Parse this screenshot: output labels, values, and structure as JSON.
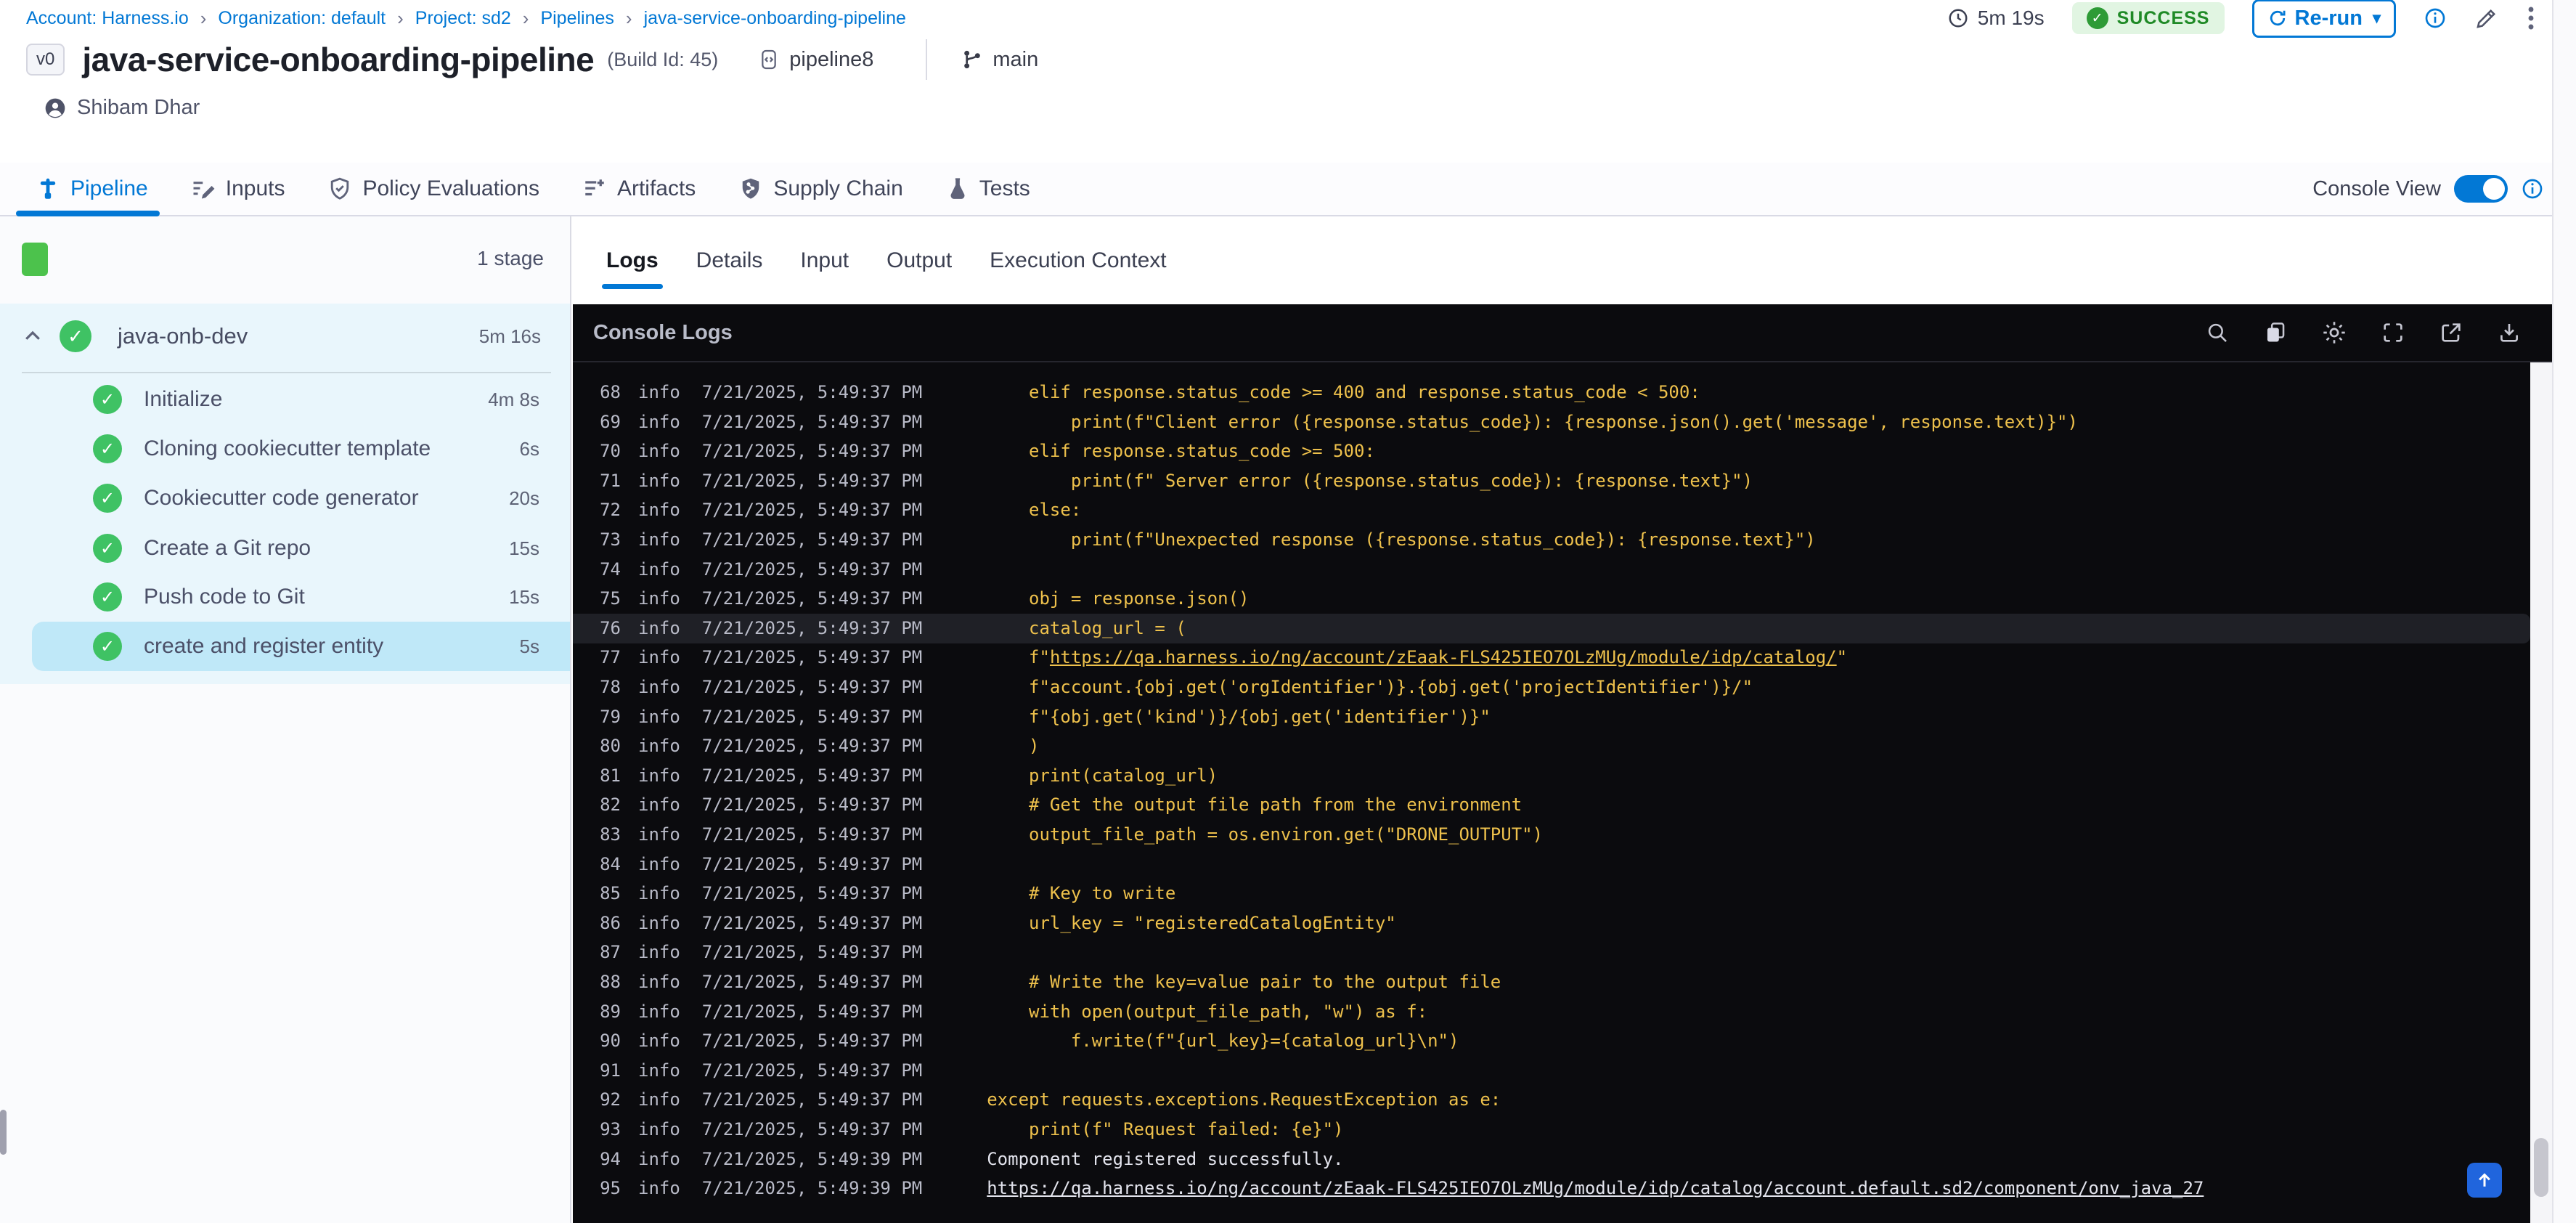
{
  "breadcrumb": {
    "items": [
      "Account: Harness.io",
      "Organization: default",
      "Project: sd2",
      "Pipelines",
      "java-service-onboarding-pipeline"
    ]
  },
  "top_actions": {
    "duration": "5m 19s",
    "status": "SUCCESS",
    "rerun_label": "Re-run"
  },
  "header": {
    "version_badge": "v0",
    "title": "java-service-onboarding-pipeline",
    "build_id": "(Build Id: 45)",
    "repo": "pipeline8",
    "branch": "main",
    "user": "Shibam Dhar"
  },
  "main_tabs": {
    "items": [
      {
        "label": "Pipeline",
        "active": true
      },
      {
        "label": "Inputs",
        "active": false
      },
      {
        "label": "Policy Evaluations",
        "active": false
      },
      {
        "label": "Artifacts",
        "active": false
      },
      {
        "label": "Supply Chain",
        "active": false
      },
      {
        "label": "Tests",
        "active": false
      }
    ],
    "console_view_label": "Console View",
    "console_view_on": true
  },
  "sidebar": {
    "stage_count": "1 stage",
    "stage": {
      "name": "java-onb-dev",
      "duration": "5m 16s"
    },
    "steps": [
      {
        "name": "Initialize",
        "duration": "4m 8s",
        "selected": false
      },
      {
        "name": "Cloning cookiecutter template",
        "duration": "6s",
        "selected": false
      },
      {
        "name": "Cookiecutter code generator",
        "duration": "20s",
        "selected": false
      },
      {
        "name": "Create a Git repo",
        "duration": "15s",
        "selected": false
      },
      {
        "name": "Push code to Git",
        "duration": "15s",
        "selected": false
      },
      {
        "name": "create and register entity",
        "duration": "5s",
        "selected": true
      }
    ]
  },
  "panel": {
    "tabs": [
      {
        "label": "Logs",
        "active": true
      },
      {
        "label": "Details",
        "active": false
      },
      {
        "label": "Input",
        "active": false
      },
      {
        "label": "Output",
        "active": false
      },
      {
        "label": "Execution Context",
        "active": false
      }
    ]
  },
  "console": {
    "title": "Console Logs",
    "icons": [
      "search",
      "copy",
      "settings",
      "fullscreen",
      "open-in-new",
      "download"
    ]
  },
  "colors": {
    "accent_blue": "#0278d5",
    "success_green": "#3fc264",
    "stage_green": "#4cc24c",
    "log_yellow": "#eec14c",
    "console_bg": "#0b0b0e",
    "selected_step_bg": "#bfe8f8",
    "stage_section_bg": "#e9f6fc"
  },
  "logs": {
    "rows": [
      {
        "n": 68,
        "level": "info",
        "ts": "7/21/2025, 5:49:37 PM",
        "pre": "    elif response.status_code >= 400 and response.status_code < 500:",
        "link": "",
        "post": "",
        "color": "code",
        "hl": false
      },
      {
        "n": 69,
        "level": "info",
        "ts": "7/21/2025, 5:49:37 PM",
        "pre": "        print(f\"Client error ({response.status_code}): {response.json().get('message', response.text)}\")",
        "link": "",
        "post": "",
        "color": "code",
        "hl": false
      },
      {
        "n": 70,
        "level": "info",
        "ts": "7/21/2025, 5:49:37 PM",
        "pre": "    elif response.status_code >= 500:",
        "link": "",
        "post": "",
        "color": "code",
        "hl": false
      },
      {
        "n": 71,
        "level": "info",
        "ts": "7/21/2025, 5:49:37 PM",
        "pre": "        print(f\" Server error ({response.status_code}): {response.text}\")",
        "link": "",
        "post": "",
        "color": "code",
        "hl": false
      },
      {
        "n": 72,
        "level": "info",
        "ts": "7/21/2025, 5:49:37 PM",
        "pre": "    else:",
        "link": "",
        "post": "",
        "color": "code",
        "hl": false
      },
      {
        "n": 73,
        "level": "info",
        "ts": "7/21/2025, 5:49:37 PM",
        "pre": "        print(f\"Unexpected response ({response.status_code}): {response.text}\")",
        "link": "",
        "post": "",
        "color": "code",
        "hl": false
      },
      {
        "n": 74,
        "level": "info",
        "ts": "7/21/2025, 5:49:37 PM",
        "pre": "",
        "link": "",
        "post": "",
        "color": "code",
        "hl": false
      },
      {
        "n": 75,
        "level": "info",
        "ts": "7/21/2025, 5:49:37 PM",
        "pre": "    obj = response.json()",
        "link": "",
        "post": "",
        "color": "code",
        "hl": false
      },
      {
        "n": 76,
        "level": "info",
        "ts": "7/21/2025, 5:49:37 PM",
        "pre": "    catalog_url = (",
        "link": "",
        "post": "",
        "color": "code",
        "hl": true
      },
      {
        "n": 77,
        "level": "info",
        "ts": "7/21/2025, 5:49:37 PM",
        "pre": "    f\"",
        "link": "https://qa.harness.io/ng/account/zEaak-FLS425IEO7OLzMUg/module/idp/catalog/",
        "post": "\"",
        "color": "code",
        "hl": false
      },
      {
        "n": 78,
        "level": "info",
        "ts": "7/21/2025, 5:49:37 PM",
        "pre": "    f\"account.{obj.get('orgIdentifier')}.{obj.get('projectIdentifier')}/\"",
        "link": "",
        "post": "",
        "color": "code",
        "hl": false
      },
      {
        "n": 79,
        "level": "info",
        "ts": "7/21/2025, 5:49:37 PM",
        "pre": "    f\"{obj.get('kind')}/{obj.get('identifier')}\"",
        "link": "",
        "post": "",
        "color": "code",
        "hl": false
      },
      {
        "n": 80,
        "level": "info",
        "ts": "7/21/2025, 5:49:37 PM",
        "pre": "    )",
        "link": "",
        "post": "",
        "color": "code",
        "hl": false
      },
      {
        "n": 81,
        "level": "info",
        "ts": "7/21/2025, 5:49:37 PM",
        "pre": "    print(catalog_url)",
        "link": "",
        "post": "",
        "color": "code",
        "hl": false
      },
      {
        "n": 82,
        "level": "info",
        "ts": "7/21/2025, 5:49:37 PM",
        "pre": "    # Get the output file path from the environment",
        "link": "",
        "post": "",
        "color": "code",
        "hl": false
      },
      {
        "n": 83,
        "level": "info",
        "ts": "7/21/2025, 5:49:37 PM",
        "pre": "    output_file_path = os.environ.get(\"DRONE_OUTPUT\")",
        "link": "",
        "post": "",
        "color": "code",
        "hl": false
      },
      {
        "n": 84,
        "level": "info",
        "ts": "7/21/2025, 5:49:37 PM",
        "pre": "",
        "link": "",
        "post": "",
        "color": "code",
        "hl": false
      },
      {
        "n": 85,
        "level": "info",
        "ts": "7/21/2025, 5:49:37 PM",
        "pre": "    # Key to write",
        "link": "",
        "post": "",
        "color": "code",
        "hl": false
      },
      {
        "n": 86,
        "level": "info",
        "ts": "7/21/2025, 5:49:37 PM",
        "pre": "    url_key = \"registeredCatalogEntity\"",
        "link": "",
        "post": "",
        "color": "code",
        "hl": false
      },
      {
        "n": 87,
        "level": "info",
        "ts": "7/21/2025, 5:49:37 PM",
        "pre": "",
        "link": "",
        "post": "",
        "color": "code",
        "hl": false
      },
      {
        "n": 88,
        "level": "info",
        "ts": "7/21/2025, 5:49:37 PM",
        "pre": "    # Write the key=value pair to the output file",
        "link": "",
        "post": "",
        "color": "code",
        "hl": false
      },
      {
        "n": 89,
        "level": "info",
        "ts": "7/21/2025, 5:49:37 PM",
        "pre": "    with open(output_file_path, \"w\") as f:",
        "link": "",
        "post": "",
        "color": "code",
        "hl": false
      },
      {
        "n": 90,
        "level": "info",
        "ts": "7/21/2025, 5:49:37 PM",
        "pre": "        f.write(f\"{url_key}={catalog_url}\\n\")",
        "link": "",
        "post": "",
        "color": "code",
        "hl": false
      },
      {
        "n": 91,
        "level": "info",
        "ts": "7/21/2025, 5:49:37 PM",
        "pre": "",
        "link": "",
        "post": "",
        "color": "code",
        "hl": false
      },
      {
        "n": 92,
        "level": "info",
        "ts": "7/21/2025, 5:49:37 PM",
        "pre": "except requests.exceptions.RequestException as e:",
        "link": "",
        "post": "",
        "color": "code",
        "hl": false
      },
      {
        "n": 93,
        "level": "info",
        "ts": "7/21/2025, 5:49:37 PM",
        "pre": "    print(f\" Request failed: {e}\")",
        "link": "",
        "post": "",
        "color": "code",
        "hl": false
      },
      {
        "n": 94,
        "level": "info",
        "ts": "7/21/2025, 5:49:39 PM",
        "pre": "Component registered successfully.",
        "link": "",
        "post": "",
        "color": "plain",
        "hl": false
      },
      {
        "n": 95,
        "level": "info",
        "ts": "7/21/2025, 5:49:39 PM",
        "pre": "",
        "link": "https://qa.harness.io/ng/account/zEaak-FLS425IEO7OLzMUg/module/idp/catalog/account.default.sd2/component/onv_java_27",
        "post": "",
        "color": "plain",
        "hl": false
      }
    ]
  }
}
